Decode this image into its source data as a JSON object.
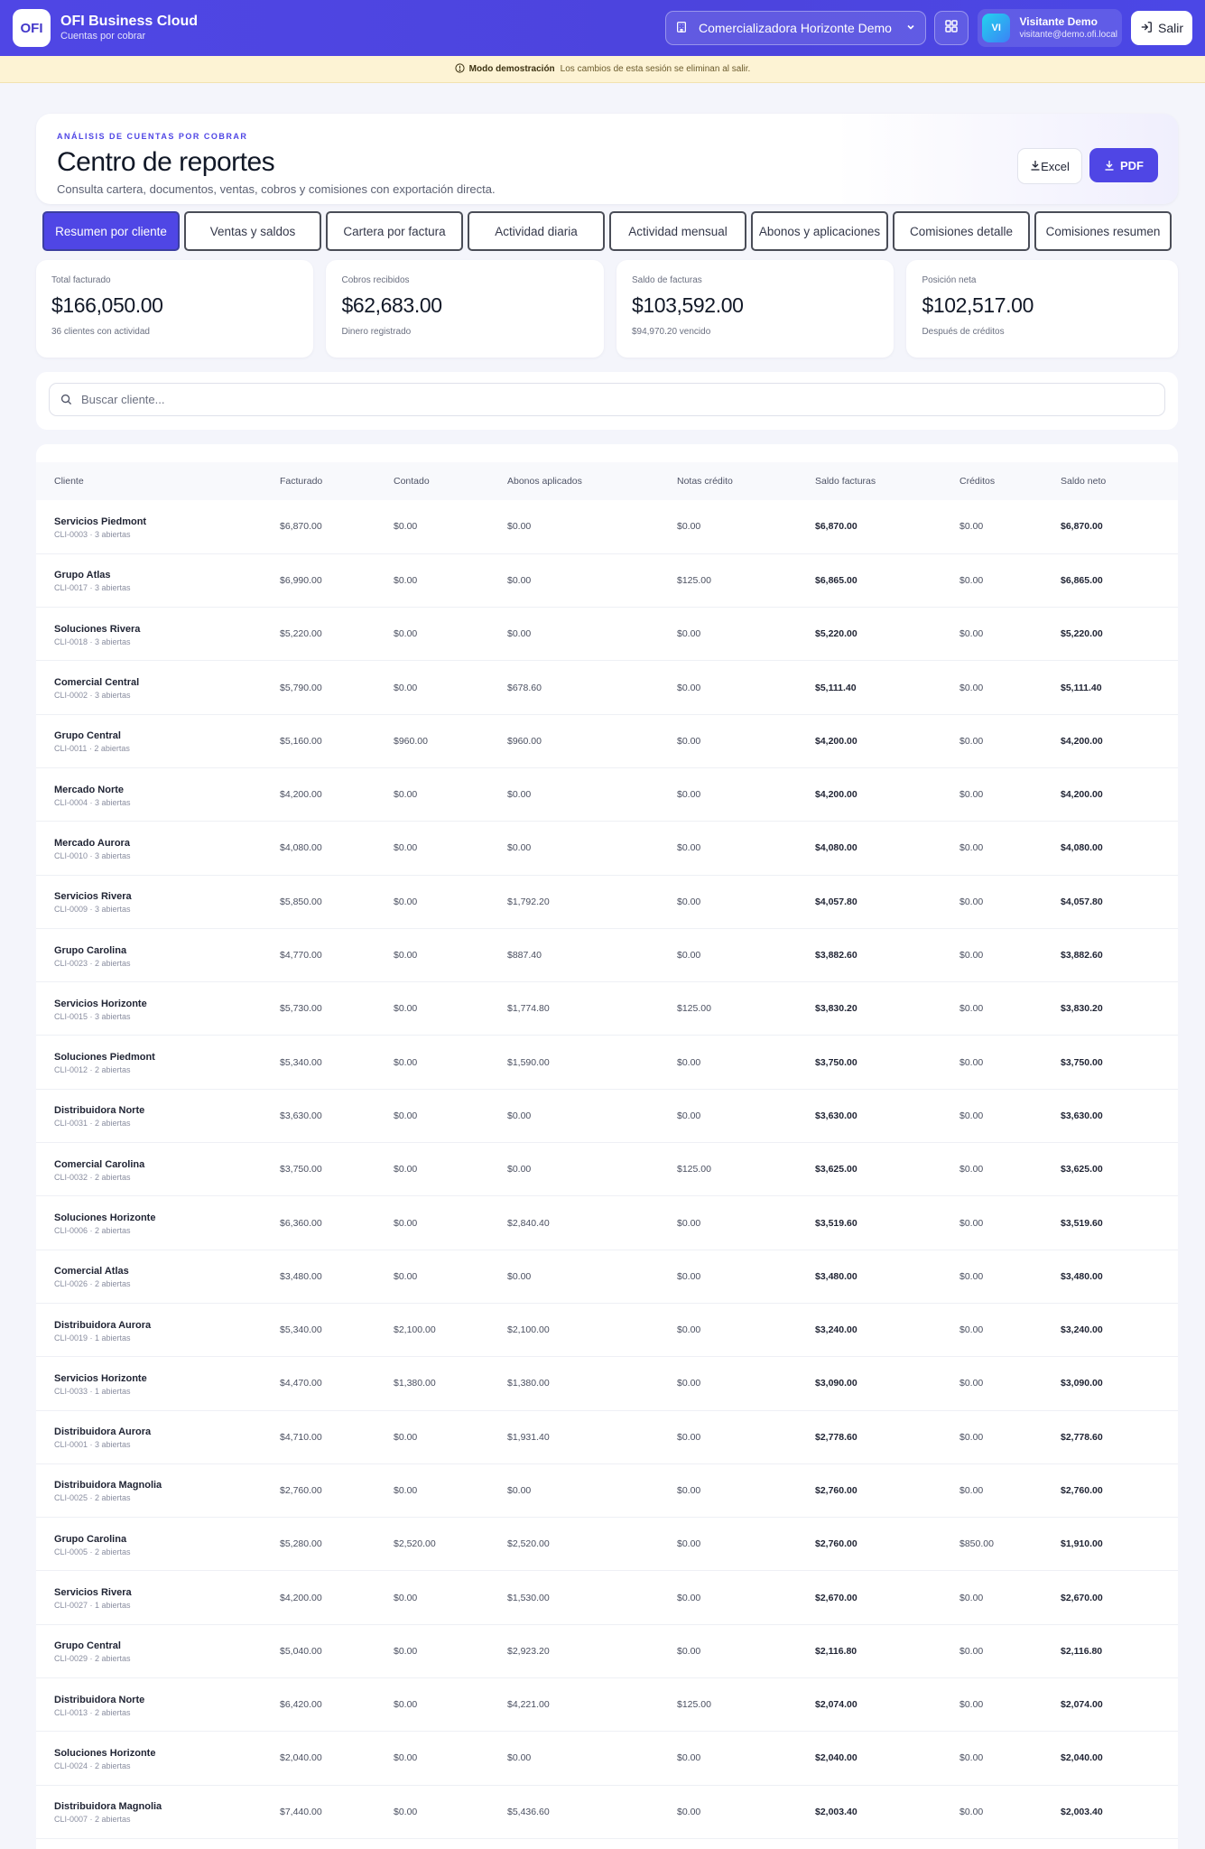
{
  "app": {
    "logo": "OFI",
    "title": "OFI Business Cloud",
    "subtitle": "Cuentas por cobrar",
    "company": "Comercializadora Horizonte Demo",
    "user_initials": "VI",
    "user_name": "Visitante Demo",
    "user_email": "visitante@demo.ofi.local",
    "logout_label": "Salir"
  },
  "banner": {
    "strong": "Modo demostración",
    "text": "Los cambios de esta sesión se eliminan al salir."
  },
  "header": {
    "eyebrow": "ANÁLISIS DE CUENTAS POR COBRAR",
    "title": "Centro de reportes",
    "description": "Consulta cartera, documentos, ventas, cobros y comisiones con exportación directa.",
    "excel_label": "Excel",
    "pdf_label": "PDF"
  },
  "tabs": [
    {
      "label": "Resumen por cliente",
      "active": true
    },
    {
      "label": "Ventas y saldos",
      "active": false
    },
    {
      "label": "Cartera por factura",
      "active": false
    },
    {
      "label": "Actividad diaria",
      "active": false
    },
    {
      "label": "Actividad mensual",
      "active": false
    },
    {
      "label": "Abonos y aplicaciones",
      "active": false
    },
    {
      "label": "Comisiones detalle",
      "active": false
    },
    {
      "label": "Comisiones resumen",
      "active": false
    }
  ],
  "kpis": [
    {
      "label": "Total facturado",
      "value": "$166,050.00",
      "note": "36 clientes con actividad"
    },
    {
      "label": "Cobros recibidos",
      "value": "$62,683.00",
      "note": "Dinero registrado"
    },
    {
      "label": "Saldo de facturas",
      "value": "$103,592.00",
      "note": "$94,970.20 vencido"
    },
    {
      "label": "Posición neta",
      "value": "$102,517.00",
      "note": "Después de créditos"
    }
  ],
  "search": {
    "placeholder": "Buscar cliente..."
  },
  "table": {
    "columns": [
      "Cliente",
      "Facturado",
      "Contado",
      "Abonos aplicados",
      "Notas crédito",
      "Saldo facturas",
      "Créditos",
      "Saldo neto"
    ],
    "rows": [
      {
        "name": "Servicios Piedmont",
        "meta": "CLI-0003 · 3 abiertas",
        "c": [
          "$6,870.00",
          "$0.00",
          "$0.00",
          "$0.00",
          "$6,870.00",
          "$0.00",
          "$6,870.00"
        ]
      },
      {
        "name": "Grupo Atlas",
        "meta": "CLI-0017 · 3 abiertas",
        "c": [
          "$6,990.00",
          "$0.00",
          "$0.00",
          "$125.00",
          "$6,865.00",
          "$0.00",
          "$6,865.00"
        ]
      },
      {
        "name": "Soluciones Rivera",
        "meta": "CLI-0018 · 3 abiertas",
        "c": [
          "$5,220.00",
          "$0.00",
          "$0.00",
          "$0.00",
          "$5,220.00",
          "$0.00",
          "$5,220.00"
        ]
      },
      {
        "name": "Comercial Central",
        "meta": "CLI-0002 · 3 abiertas",
        "c": [
          "$5,790.00",
          "$0.00",
          "$678.60",
          "$0.00",
          "$5,111.40",
          "$0.00",
          "$5,111.40"
        ]
      },
      {
        "name": "Grupo Central",
        "meta": "CLI-0011 · 2 abiertas",
        "c": [
          "$5,160.00",
          "$960.00",
          "$960.00",
          "$0.00",
          "$4,200.00",
          "$0.00",
          "$4,200.00"
        ]
      },
      {
        "name": "Mercado Norte",
        "meta": "CLI-0004 · 3 abiertas",
        "c": [
          "$4,200.00",
          "$0.00",
          "$0.00",
          "$0.00",
          "$4,200.00",
          "$0.00",
          "$4,200.00"
        ]
      },
      {
        "name": "Mercado Aurora",
        "meta": "CLI-0010 · 3 abiertas",
        "c": [
          "$4,080.00",
          "$0.00",
          "$0.00",
          "$0.00",
          "$4,080.00",
          "$0.00",
          "$4,080.00"
        ]
      },
      {
        "name": "Servicios Rivera",
        "meta": "CLI-0009 · 3 abiertas",
        "c": [
          "$5,850.00",
          "$0.00",
          "$1,792.20",
          "$0.00",
          "$4,057.80",
          "$0.00",
          "$4,057.80"
        ]
      },
      {
        "name": "Grupo Carolina",
        "meta": "CLI-0023 · 2 abiertas",
        "c": [
          "$4,770.00",
          "$0.00",
          "$887.40",
          "$0.00",
          "$3,882.60",
          "$0.00",
          "$3,882.60"
        ]
      },
      {
        "name": "Servicios Horizonte",
        "meta": "CLI-0015 · 3 abiertas",
        "c": [
          "$5,730.00",
          "$0.00",
          "$1,774.80",
          "$125.00",
          "$3,830.20",
          "$0.00",
          "$3,830.20"
        ]
      },
      {
        "name": "Soluciones Piedmont",
        "meta": "CLI-0012 · 2 abiertas",
        "c": [
          "$5,340.00",
          "$0.00",
          "$1,590.00",
          "$0.00",
          "$3,750.00",
          "$0.00",
          "$3,750.00"
        ]
      },
      {
        "name": "Distribuidora Norte",
        "meta": "CLI-0031 · 2 abiertas",
        "c": [
          "$3,630.00",
          "$0.00",
          "$0.00",
          "$0.00",
          "$3,630.00",
          "$0.00",
          "$3,630.00"
        ]
      },
      {
        "name": "Comercial Carolina",
        "meta": "CLI-0032 · 2 abiertas",
        "c": [
          "$3,750.00",
          "$0.00",
          "$0.00",
          "$125.00",
          "$3,625.00",
          "$0.00",
          "$3,625.00"
        ]
      },
      {
        "name": "Soluciones Horizonte",
        "meta": "CLI-0006 · 2 abiertas",
        "c": [
          "$6,360.00",
          "$0.00",
          "$2,840.40",
          "$0.00",
          "$3,519.60",
          "$0.00",
          "$3,519.60"
        ]
      },
      {
        "name": "Comercial Atlas",
        "meta": "CLI-0026 · 2 abiertas",
        "c": [
          "$3,480.00",
          "$0.00",
          "$0.00",
          "$0.00",
          "$3,480.00",
          "$0.00",
          "$3,480.00"
        ]
      },
      {
        "name": "Distribuidora Aurora",
        "meta": "CLI-0019 · 1 abiertas",
        "c": [
          "$5,340.00",
          "$2,100.00",
          "$2,100.00",
          "$0.00",
          "$3,240.00",
          "$0.00",
          "$3,240.00"
        ]
      },
      {
        "name": "Servicios Horizonte",
        "meta": "CLI-0033 · 1 abiertas",
        "c": [
          "$4,470.00",
          "$1,380.00",
          "$1,380.00",
          "$0.00",
          "$3,090.00",
          "$0.00",
          "$3,090.00"
        ]
      },
      {
        "name": "Distribuidora Aurora",
        "meta": "CLI-0001 · 3 abiertas",
        "c": [
          "$4,710.00",
          "$0.00",
          "$1,931.40",
          "$0.00",
          "$2,778.60",
          "$0.00",
          "$2,778.60"
        ]
      },
      {
        "name": "Distribuidora Magnolia",
        "meta": "CLI-0025 · 2 abiertas",
        "c": [
          "$2,760.00",
          "$0.00",
          "$0.00",
          "$0.00",
          "$2,760.00",
          "$0.00",
          "$2,760.00"
        ]
      },
      {
        "name": "Grupo Carolina",
        "meta": "CLI-0005 · 2 abiertas",
        "c": [
          "$5,280.00",
          "$2,520.00",
          "$2,520.00",
          "$0.00",
          "$2,760.00",
          "$850.00",
          "$1,910.00"
        ]
      },
      {
        "name": "Servicios Rivera",
        "meta": "CLI-0027 · 1 abiertas",
        "c": [
          "$4,200.00",
          "$0.00",
          "$1,530.00",
          "$0.00",
          "$2,670.00",
          "$0.00",
          "$2,670.00"
        ]
      },
      {
        "name": "Grupo Central",
        "meta": "CLI-0029 · 2 abiertas",
        "c": [
          "$5,040.00",
          "$0.00",
          "$2,923.20",
          "$0.00",
          "$2,116.80",
          "$0.00",
          "$2,116.80"
        ]
      },
      {
        "name": "Distribuidora Norte",
        "meta": "CLI-0013 · 2 abiertas",
        "c": [
          "$6,420.00",
          "$0.00",
          "$4,221.00",
          "$125.00",
          "$2,074.00",
          "$0.00",
          "$2,074.00"
        ]
      },
      {
        "name": "Soluciones Horizonte",
        "meta": "CLI-0024 · 2 abiertas",
        "c": [
          "$2,040.00",
          "$0.00",
          "$0.00",
          "$0.00",
          "$2,040.00",
          "$0.00",
          "$2,040.00"
        ]
      },
      {
        "name": "Distribuidora Magnolia",
        "meta": "CLI-0007 · 2 abiertas",
        "c": [
          "$7,440.00",
          "$0.00",
          "$5,436.60",
          "$0.00",
          "$2,003.40",
          "$0.00",
          "$2,003.40"
        ]
      }
    ]
  },
  "colors": {
    "primary": "#4f46e5",
    "banner": "#fdf3d4"
  },
  "icons": [
    "building-icon",
    "chevron-down-icon",
    "apps-grid-icon",
    "logout-icon",
    "info-icon",
    "download-icon",
    "search-icon"
  ]
}
